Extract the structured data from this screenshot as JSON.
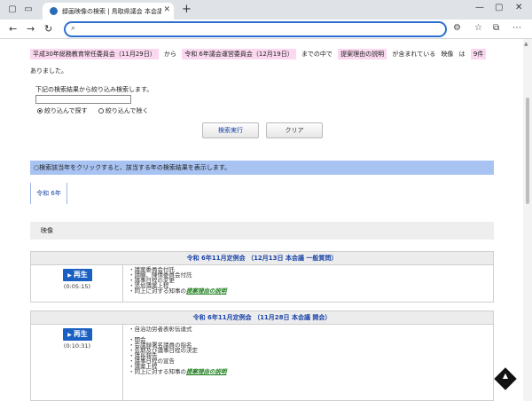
{
  "browser": {
    "tab_title": "録画映像の検索 | 鳥取県議会 本会議",
    "new_tab": "+",
    "url": ""
  },
  "summary": {
    "from_committee": "平成30年総務教育常任委員会（11月29日）",
    "from_word": "から",
    "to_committee": "令和 6年議会運営委員会（12月19日）",
    "to_word": "までの中で",
    "keyword": "提案理由の説明",
    "contains_word": "が含まれている",
    "video_word": "映像",
    "wa": "は",
    "count": "9件",
    "tail": "ありました。"
  },
  "refine": {
    "label": "下記の検索結果から絞り込み検索します。",
    "input_value": "",
    "radio_include": "絞り込んで探す",
    "radio_exclude": "絞り込んで除く"
  },
  "buttons": {
    "search": "検索実行",
    "clear": "クリア"
  },
  "info_bar": "○検索該当年をクリックすると、該当する年の検索結果を表示します。",
  "year_tab": "令和 6年",
  "video_heading": "映像",
  "results": [
    {
      "title": "令和 6年11月定例会 （12月13日 本会議 一般質問）",
      "play": "再生",
      "duration": "(0:05:15)",
      "items": [
        "・議案委員会付託",
        "・請願、陳情委員会付託",
        "・議事日程の変更",
        "・追加議案上程",
        "・同上に対する知事の"
      ],
      "link": "提案理由の説明"
    },
    {
      "title": "令和 6年11月定例会 （11月28日 本会議 開会）",
      "play": "再生",
      "duration": "(0:10:31)",
      "items": [
        "・自治功労者表彰伝達式",
        "",
        "・開会",
        "・会議録署名議員の指名",
        "・会期及び議事日程の決定",
        "・議長報告",
        "・議事日程の宣告",
        "・議案上程",
        "・同上に対する知事の"
      ],
      "link": "提案理由の説明"
    }
  ]
}
